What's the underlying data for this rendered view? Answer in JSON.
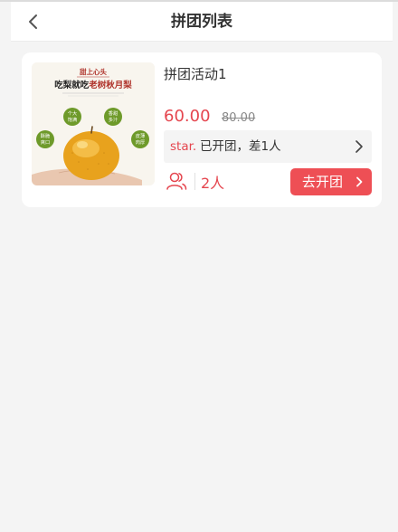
{
  "header": {
    "title": "拼团列表"
  },
  "groups": [
    {
      "title": "拼团活动1",
      "price": "60.00",
      "original_price": "80.00",
      "group": {
        "user": "star.",
        "status": "已开团，差1人"
      },
      "people": "2人",
      "open_button": "去开团",
      "image": {
        "brand": "甜上心头",
        "headline_plain": "吃梨就吃",
        "headline_accent": "老树秋月梨",
        "badges": [
          {
            "line1": "个大",
            "line2": "饱满"
          },
          {
            "line1": "香甜",
            "line2": "多汁"
          },
          {
            "line1": "酥脆",
            "line2": "爽口"
          },
          {
            "line1": "皮薄",
            "line2": "肉厚"
          }
        ]
      }
    }
  ],
  "colors": {
    "accent": "#e5464f",
    "button": "#ee4f55",
    "badge_green": "#6e9a2a",
    "background": "#f4f4f4"
  }
}
